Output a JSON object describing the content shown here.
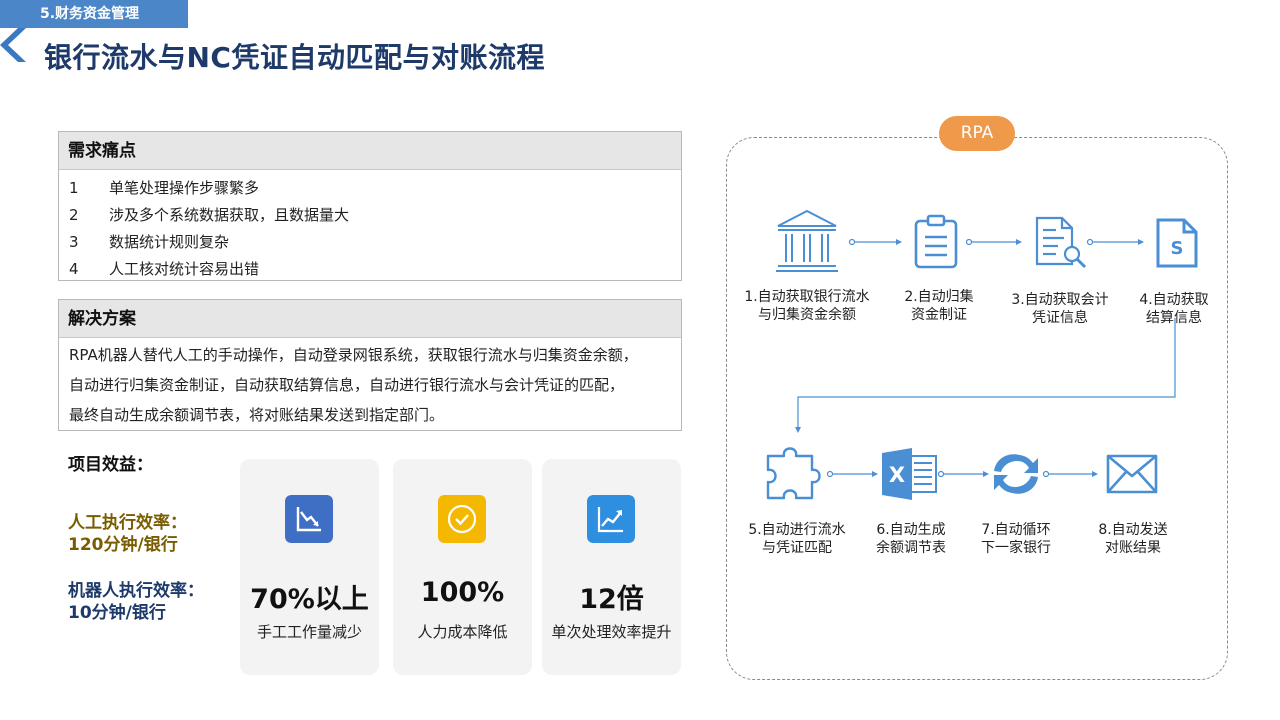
{
  "header": {
    "section_tag": "5.财务资金管理",
    "title": "银行流水与NC凭证自动匹配与对账流程"
  },
  "needs": {
    "title": "需求痛点",
    "items": [
      {
        "num": "1",
        "text": "单笔处理操作步骤繁多"
      },
      {
        "num": "2",
        "text": "涉及多个系统数据获取，且数据量大"
      },
      {
        "num": "3",
        "text": "数据统计规则复杂"
      },
      {
        "num": "4",
        "text": "人工核对统计容易出错"
      }
    ]
  },
  "solution": {
    "title": "解决方案",
    "lines": [
      "RPA机器人替代人工的手动操作，自动登录网银系统，获取银行流水与归集资金余额，",
      "自动进行归集资金制证，自动获取结算信息，自动进行银行流水与会计凭证的匹配，",
      "最终自动生成余额调节表，将对账结果发送到指定部门。"
    ]
  },
  "benefits": {
    "title": "项目效益：",
    "manual_line1": "人工执行效率：",
    "manual_line2": "120分钟/银行",
    "robot_line1": "机器人执行效率：",
    "robot_line2": "10分钟/银行",
    "cards": [
      {
        "value": "70%以上",
        "label": "手工工作量减少",
        "icon": "chart-down-icon",
        "color": "#3f6fc4"
      },
      {
        "value": "100%",
        "label": "人力成本降低",
        "icon": "check-circle-icon",
        "color": "#f5b800"
      },
      {
        "value": "12倍",
        "label": "单次处理效率提升",
        "icon": "chart-up-icon",
        "color": "#2e8fe0"
      }
    ]
  },
  "rpa": {
    "badge": "RPA",
    "accent": "#4a8fd4",
    "steps": [
      {
        "line1": "1.自动获取银行流水",
        "line2": "与归集资金余额",
        "icon": "bank-icon"
      },
      {
        "line1": "2.自动归集",
        "line2": "资金制证",
        "icon": "clipboard-icon"
      },
      {
        "line1": "3.自动获取会计",
        "line2": "凭证信息",
        "icon": "document-search-icon"
      },
      {
        "line1": "4.自动获取",
        "line2": "结算信息",
        "icon": "file-s-icon"
      },
      {
        "line1": "5.自动进行流水",
        "line2": "与凭证匹配",
        "icon": "puzzle-icon"
      },
      {
        "line1": "6.自动生成",
        "line2": "余额调节表",
        "icon": "excel-icon"
      },
      {
        "line1": "7.自动循环",
        "line2": "下一家银行",
        "icon": "refresh-icon"
      },
      {
        "line1": "8.自动发送",
        "line2": "对账结果",
        "icon": "mail-icon"
      }
    ]
  }
}
